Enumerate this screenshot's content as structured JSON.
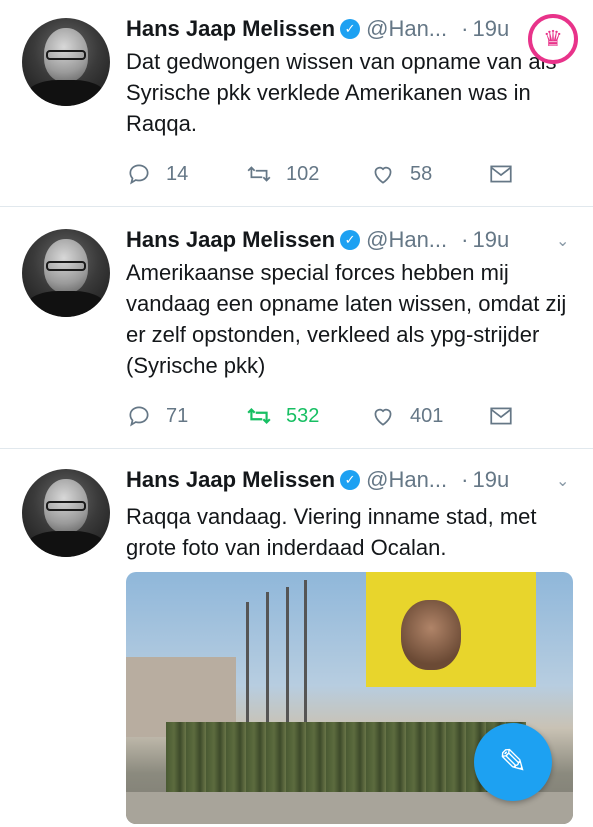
{
  "tweets": [
    {
      "name": "Hans Jaap Melissen",
      "handle": "@Han...",
      "separator": "·",
      "time": "19u",
      "text": "Dat gedwongen wissen van opname van als Syrische pkk verklede Amerikanen was in Raqqa.",
      "replies": "14",
      "retweets": "102",
      "likes": "58",
      "retweeted": false
    },
    {
      "name": "Hans Jaap Melissen",
      "handle": "@Han...",
      "separator": "·",
      "time": "19u",
      "text": "Amerikaanse special forces hebben mij vandaag een opname laten wissen, omdat zij er zelf opstonden, verkleed als ypg-strijder (Syrische pkk)",
      "replies": "71",
      "retweets": "532",
      "likes": "401",
      "retweeted": true
    },
    {
      "name": "Hans Jaap Melissen",
      "handle": "@Han...",
      "separator": "·",
      "time": "19u",
      "text": "Raqqa vandaag. Viering inname stad, met grote foto van inderdaad Ocalan.",
      "has_media": true
    }
  ],
  "icons": {
    "verified": "verified-badge-icon",
    "reply": "reply-icon",
    "retweet": "retweet-icon",
    "like": "heart-icon",
    "dm": "envelope-icon",
    "more": "chevron-down-icon",
    "compose": "compose-tweet-icon",
    "watermark": "crown-watermark-icon"
  },
  "colors": {
    "accent": "#1da1f2",
    "retweet_active": "#17bf63",
    "muted": "#657786",
    "watermark": "#e8338a"
  }
}
